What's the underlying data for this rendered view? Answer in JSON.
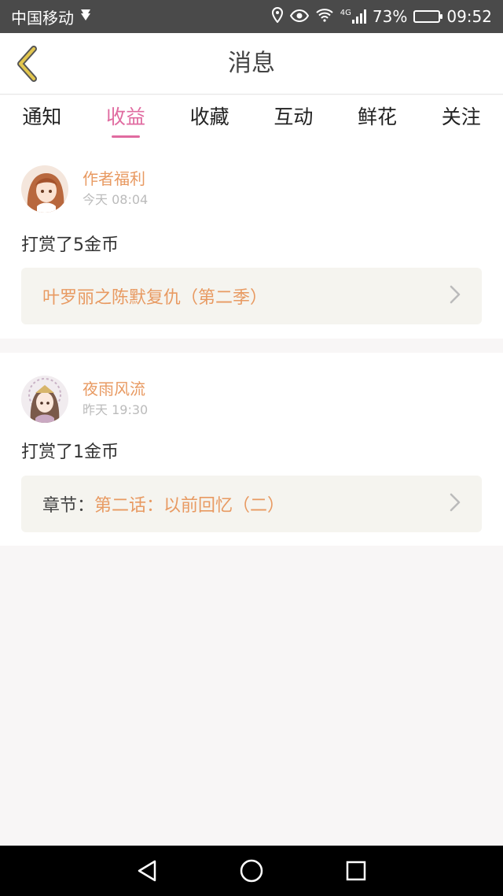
{
  "status_bar": {
    "carrier": "中国移动",
    "network": "4G",
    "battery": "73%",
    "battery_level": 0.73,
    "time": "09:52"
  },
  "header": {
    "title": "消息",
    "back_icon": "chevron-left-icon"
  },
  "tabs": [
    {
      "label": "通知",
      "active": false
    },
    {
      "label": "收益",
      "active": true
    },
    {
      "label": "收藏",
      "active": false
    },
    {
      "label": "互动",
      "active": false
    },
    {
      "label": "鲜花",
      "active": false
    },
    {
      "label": "关注",
      "active": false
    }
  ],
  "messages": [
    {
      "username": "作者福利",
      "time": "今天 08:04",
      "action": "打赏了5金币",
      "link_prefix": "",
      "link_text": "叶罗丽之陈默复仇（第二季）"
    },
    {
      "username": "夜雨风流",
      "time": "昨天 19:30",
      "action": "打赏了1金币",
      "link_prefix": "章节：",
      "link_text": "第二话：以前回忆（二）"
    }
  ],
  "colors": {
    "accent": "#e06ba0",
    "username": "#e89a62",
    "back_icon": "#d4b84a"
  }
}
